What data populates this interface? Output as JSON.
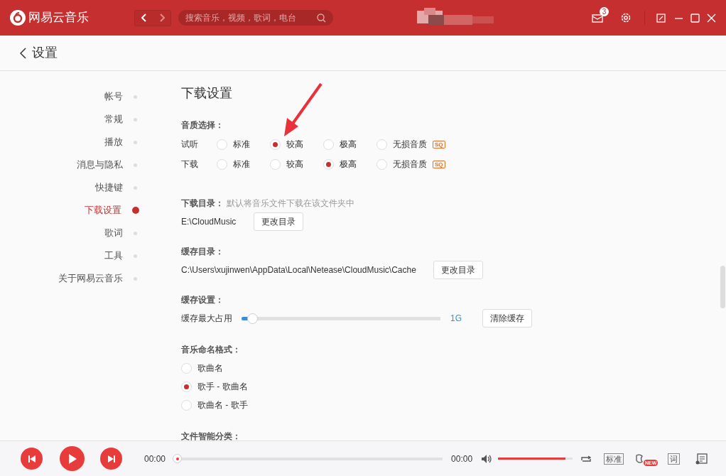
{
  "app": {
    "name": "网易云音乐"
  },
  "search": {
    "placeholder": "搜索音乐，视频，歌词，电台"
  },
  "messages": {
    "badge": "3"
  },
  "page": {
    "title": "设置"
  },
  "nav": [
    {
      "label": "帐号",
      "selected": false
    },
    {
      "label": "常规",
      "selected": false
    },
    {
      "label": "播放",
      "selected": false
    },
    {
      "label": "消息与隐私",
      "selected": false
    },
    {
      "label": "快捷键",
      "selected": false
    },
    {
      "label": "下载设置",
      "selected": true
    },
    {
      "label": "歌词",
      "selected": false
    },
    {
      "label": "工具",
      "selected": false
    },
    {
      "label": "关于网易云音乐",
      "selected": false
    }
  ],
  "section_title": "下载设置",
  "quality": {
    "label": "音质选择：",
    "rows": [
      {
        "label": "试听",
        "options": [
          {
            "label": "标准",
            "selected": false
          },
          {
            "label": "较高",
            "selected": true
          },
          {
            "label": "极高",
            "selected": false
          },
          {
            "label": "无损音质",
            "selected": false,
            "badge": "SQ"
          }
        ]
      },
      {
        "label": "下载",
        "options": [
          {
            "label": "标准",
            "selected": false
          },
          {
            "label": "较高",
            "selected": false
          },
          {
            "label": "极高",
            "selected": true
          },
          {
            "label": "无损音质",
            "selected": false,
            "badge": "SQ"
          }
        ]
      }
    ]
  },
  "download_dir": {
    "label": "下载目录：",
    "hint": "默认将音乐文件下载在该文件夹中",
    "path": "E:\\CloudMusic",
    "button": "更改目录"
  },
  "cache_dir": {
    "label": "缓存目录：",
    "path": "C:\\Users\\xujinwen\\AppData\\Local\\Netease\\CloudMusic\\Cache",
    "button": "更改目录"
  },
  "cache": {
    "label": "缓存设置：",
    "slider_label": "缓存最大占用",
    "level": 0.03,
    "reading": "1G",
    "button": "清除缓存"
  },
  "naming": {
    "label": "音乐命名格式：",
    "options": [
      {
        "label": "歌曲名",
        "selected": false
      },
      {
        "label": "歌手 - 歌曲名",
        "selected": true
      },
      {
        "label": "歌曲名 - 歌手",
        "selected": false
      }
    ]
  },
  "smart": {
    "label": "文件智能分类："
  },
  "player": {
    "elapsed": "00:00",
    "total": "00:00",
    "volume": {
      "level": 0.9
    },
    "quality": "标准",
    "lyrics": "词",
    "new_badge": "NEW"
  }
}
